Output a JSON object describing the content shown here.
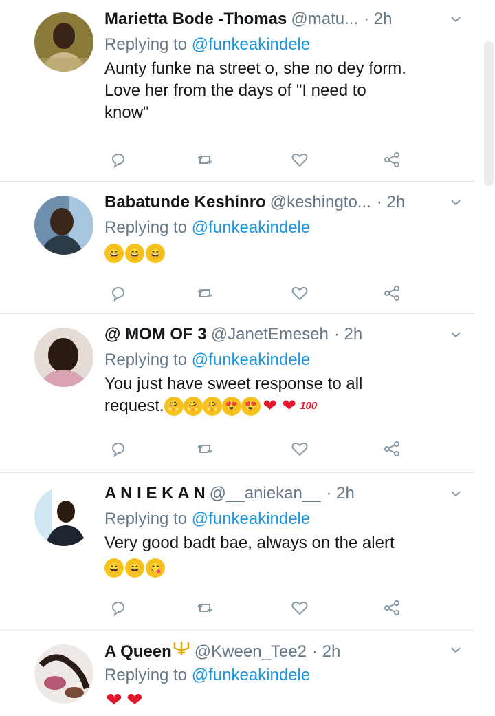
{
  "tweets": [
    {
      "name": "Marietta Bode -Thomas",
      "handle": "@matu...",
      "time": "· 2h",
      "replying_prefix": "Replying to",
      "replying_to": "@funkeakindele",
      "text_lines": [
        "Aunty funke na street o, she no dey form.",
        "Love her from the days of \"I need to",
        "know\""
      ]
    },
    {
      "name": "Babatunde Keshinro",
      "handle": "@keshingto...",
      "time": "· 2h",
      "replying_prefix": "Replying to",
      "replying_to": "@funkeakindele",
      "emojis": [
        "grin",
        "grin",
        "grin"
      ]
    },
    {
      "name": "@ MOM OF 3",
      "handle": "@JanetEmeseh",
      "time": "· 2h",
      "replying_prefix": "Replying to",
      "replying_to": "@funkeakindele",
      "text_lines": [
        "You just have sweet response to all",
        "request."
      ],
      "emojis": [
        "hug",
        "hug",
        "hug",
        "heart-eyes",
        "heart-eyes",
        "heart",
        "heart",
        "hundred"
      ]
    },
    {
      "name": "A N I E K A N",
      "handle": "@__aniekan__",
      "time": "· 2h",
      "replying_prefix": "Replying to",
      "replying_to": "@funkeakindele",
      "text_lines": [
        "Very good badt bae, always on the alert"
      ],
      "emojis": [
        "grin",
        "grin",
        "yum"
      ]
    },
    {
      "name": "A Queen",
      "handle": "@Kween_Tee2",
      "time": "· 2h",
      "replying_prefix": "Replying to",
      "replying_to": "@funkeakindele",
      "emojis": [
        "heart",
        "heart"
      ]
    }
  ],
  "colors": {
    "link": "#1b95e0",
    "muted": "#657786",
    "text": "#14171a",
    "divider": "#e1e8ed"
  },
  "icons": [
    "reply-icon",
    "retweet-icon",
    "like-icon",
    "share-icon",
    "caret-down-icon",
    "trident-icon"
  ]
}
